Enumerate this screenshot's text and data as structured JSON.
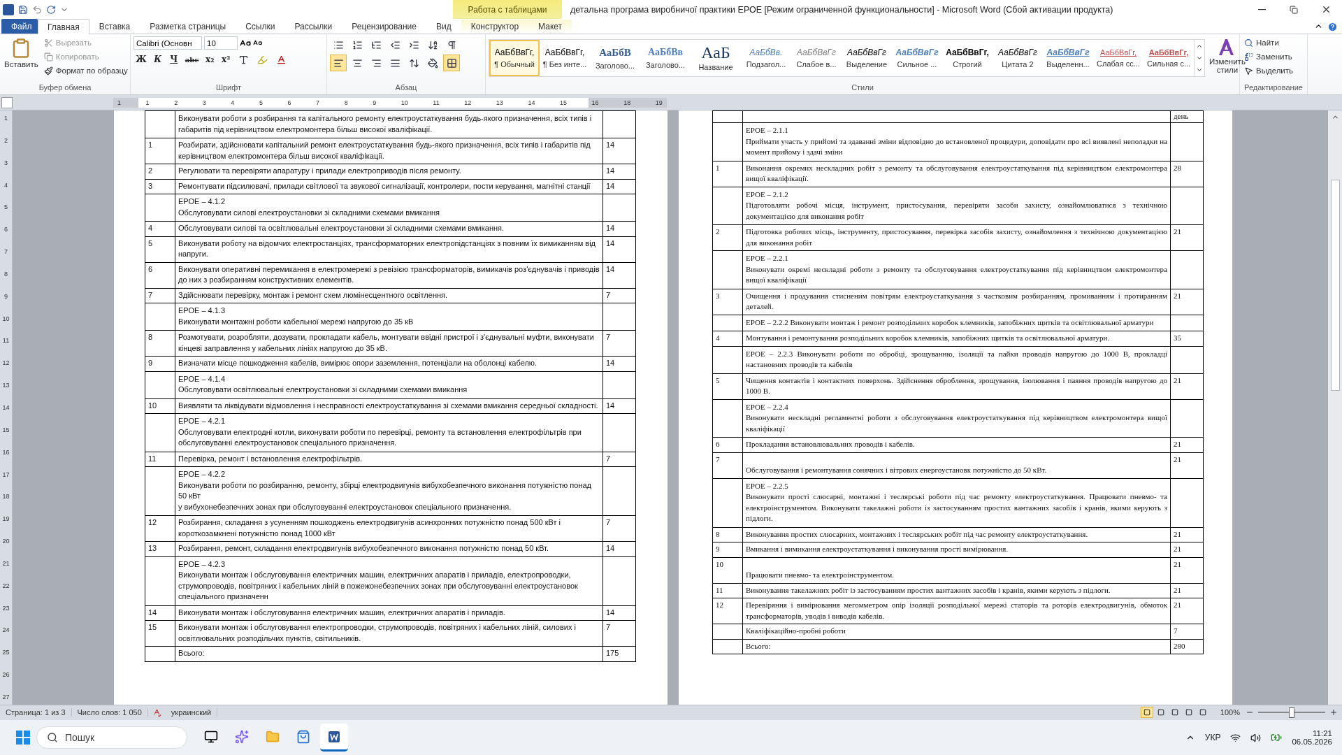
{
  "title_bar": {
    "title": "детальна програма виробничої практики ЕРОЕ [Режим ограниченной функциональности]  -  Microsoft Word (Сбой активации продукта)",
    "context_group": "Работа с таблицами"
  },
  "tabs": [
    {
      "label": "Файл",
      "kind": "file",
      "selected": false
    },
    {
      "label": "Главная",
      "kind": "tab",
      "selected": true
    },
    {
      "label": "Вставка",
      "kind": "tab",
      "selected": false
    },
    {
      "label": "Разметка страницы",
      "kind": "tab",
      "selected": false
    },
    {
      "label": "Ссылки",
      "kind": "tab",
      "selected": false
    },
    {
      "label": "Рассылки",
      "kind": "tab",
      "selected": false
    },
    {
      "label": "Рецензирование",
      "kind": "tab",
      "selected": false
    },
    {
      "label": "Вид",
      "kind": "tab",
      "selected": false
    },
    {
      "label": "Конструктор",
      "kind": "context",
      "selected": false
    },
    {
      "label": "Макет",
      "kind": "context",
      "selected": false
    }
  ],
  "clipboard": {
    "paste": "Вставить",
    "items": [
      {
        "label": "Вырезать",
        "disabled": true
      },
      {
        "label": "Копировать",
        "disabled": true
      },
      {
        "label": "Формат по образцу",
        "disabled": false
      }
    ],
    "group": "Буфер обмена"
  },
  "font": {
    "name": "Calibri (Основн",
    "size": "10",
    "format_buttons": [
      "Ж",
      "К",
      "Ч",
      "abc",
      "x₂",
      "x²"
    ],
    "group": "Шрифт"
  },
  "paragraph": {
    "alignment": [
      {
        "selected": true
      },
      {
        "selected": false
      },
      {
        "selected": false
      },
      {
        "selected": false
      }
    ],
    "group": "Абзац"
  },
  "styles": {
    "items": [
      {
        "preview": "АаБбВвГг,",
        "label": "¶ Обычный",
        "selected": true
      },
      {
        "preview": "АаБбВвГг,",
        "label": "¶ Без инте...",
        "selected": false
      },
      {
        "preview": "АаБбВ",
        "label": "Заголово...",
        "selected": false
      },
      {
        "preview": "АаБбВв",
        "label": "Заголово...",
        "selected": false
      },
      {
        "preview": "АаБ",
        "label": "Название",
        "selected": false
      },
      {
        "preview": "АаБбВв.",
        "label": "Подзагол...",
        "selected": false
      },
      {
        "preview": "АаБбВвГг",
        "label": "Слабое в...",
        "selected": false
      },
      {
        "preview": "АаБбВвГг",
        "label": "Выделение",
        "selected": false
      },
      {
        "preview": "АаБбВвГг",
        "label": "Сильное ...",
        "selected": false
      },
      {
        "preview": "АаБбВвГг,",
        "label": "Строгий",
        "selected": false
      },
      {
        "preview": "АаБбВвГг",
        "label": "Цитата 2",
        "selected": false
      },
      {
        "preview": "АаБбВвГг",
        "label": "Выделенн...",
        "selected": false
      },
      {
        "preview": "АаБбВвГг,",
        "label": "Слабая сс...",
        "selected": false
      },
      {
        "preview": "АаБбВвГг,",
        "label": "Сильная с...",
        "selected": false
      }
    ],
    "change": [
      "Изменить",
      "стили"
    ],
    "group": "Стили"
  },
  "editing": {
    "items": [
      "Найти",
      "Заменить",
      "Выделить"
    ],
    "group": "Редактирование"
  },
  "ruler": [
    "1",
    "1",
    "2",
    "3",
    "4",
    "5",
    "6",
    "7",
    "8",
    "9",
    "10",
    "11",
    "12",
    "13",
    "14",
    "15",
    "16",
    "18",
    "19"
  ],
  "vertical_ruler": [
    "1",
    "2",
    "3",
    "4",
    "5",
    "6",
    "7",
    "8",
    "9",
    "10",
    "11",
    "12",
    "13",
    "14",
    "15",
    "16",
    "17",
    "18",
    "19",
    "20",
    "21",
    "22",
    "23",
    "24",
    "25",
    "26",
    "27"
  ],
  "left_table": [
    {
      "kind": "competency",
      "text": "Виконувати роботи з розбирання та капітального ремонту електроустаткування будь-якого призначення, всіх типів і габаритів під керівництвом електромонтера більш високої кваліфікації."
    },
    {
      "kind": "task",
      "number": "1",
      "text": "Розбирати, здійснювати капітальний ремонт електроустаткування будь-якого призначення, всіх типів і габаритів під керівництвом електромонтера більш високої кваліфікації.",
      "hours": "14"
    },
    {
      "kind": "task",
      "number": "2",
      "text": "Регулювати та перевіряти апаратуру і прилади електроприводів після ремонту.",
      "hours": "14"
    },
    {
      "kind": "task",
      "number": "3",
      "text": "Ремонтувати  підсилювачі, прилади світлової та звукової сигналізації, контролери, пости керування, магнітні станції",
      "hours": "14"
    },
    {
      "kind": "competency",
      "code": "ЕРОЕ  –  4.1.2",
      "text": "Обслуговувати силові електроустановки зі складними схемами вмикання"
    },
    {
      "kind": "task",
      "number": "4",
      "text": "Обслуговувати силові та освітлювальні  електроустановки зі складними схемами вмикання.",
      "hours": "14"
    },
    {
      "kind": "task",
      "number": "5",
      "text": "Виконувати роботу на відомчих електростанціях, трансформаторних електропідстанціях з повним їх вимиканням від напруги.",
      "hours": "14"
    },
    {
      "kind": "task",
      "number": "6",
      "text": "Виконувати оперативні перемикання в електромережі з ревізією трансформаторів, вимикачів роз'єднувачів і приводів до них з розбиранням конструктивних елементів.",
      "hours": "14"
    },
    {
      "kind": "task",
      "number": "7",
      "text": "Здійснювати  перевірку, монтаж і ремонт схем люмінесцентного освітлення.",
      "hours": "7"
    },
    {
      "kind": "competency",
      "code": "ЕРОЕ  –  4.1.3",
      "text": "Виконувати монтажні роботи кабельної мережі напругою до 35 кВ"
    },
    {
      "kind": "task",
      "number": "8",
      "text": "Розмотувати, розробляти, дозувати, прокладати кабель, монтувати  ввідні пристрої і з'єднувальні муфти, виконувати кінцеві заправлення у кабельних лініях напругою до 35 кВ.",
      "hours": "7"
    },
    {
      "kind": "task",
      "number": "9",
      "text": "Визначати місце пошкодження кабелів, вимірює опори заземлення, потенціали на оболонці кабелю.",
      "hours": "14"
    },
    {
      "kind": "competency",
      "code": "ЕРОЕ – 4.1.4",
      "text": "Обслуговувати освітлювальні електроустановки зі складними схемами вмикання"
    },
    {
      "kind": "task",
      "number": "10",
      "text": " Виявляти та ліквідувати відмовлення і несправності електроустаткування зі схемами вмикання середньої складності.",
      "hours": "14"
    },
    {
      "kind": "competency",
      "code": "ЕРОЕ  –  4.2.1",
      "text": "Обслуговувати електродні котли, виконувати роботи по перевірці, ремонту та встановлення електрофільтрів при обслуговуванні електроустановок спеціального призначення."
    },
    {
      "kind": "task",
      "number": "11",
      "text": "Перевірка, ремонт і встановлення електрофільтрів.",
      "hours": "7"
    },
    {
      "kind": "competency",
      "code": "ЕРОЕ  –  4.2.2",
      "text": "Виконувати роботи по розбиранню, ремонту, збірці електродвигунів вибухобезпечного виконання потужністю понад 50 кВт\nу вибухонебезпечних зонах при обслуговуванні електроустановок спеціального призначення."
    },
    {
      "kind": "task",
      "number": "12",
      "text": "Розбирання, складання з усуненням пошкоджень електродвигунів  асинхронних  потужністю понад 500 кВт і короткозамкнені потужністю понад 1000 кВт",
      "hours": "7"
    },
    {
      "kind": "task",
      "number": "13",
      "text": "Розбирання, ремонт, складання електродвигунів вибухобезпечного виконання потужністю понад 50 кВт.",
      "hours": "14"
    },
    {
      "kind": "competency",
      "code": "ЕРОЕ  –  4.2.3",
      "text": "Виконувати монтаж і обслуговування електричних машин, електричних апаратів і приладів, електропроводки, струмопроводів, повітряних і кабельних ліній в пожежонебезпечних зонах при обслуговуванні електроустановок спеціального призначенн"
    },
    {
      "kind": "task",
      "number": "14",
      "text": "Виконувати монтаж і обслуговування електричних машин, електричних апаратів і приладів.",
      "hours": "14"
    },
    {
      "kind": "task",
      "number": "15",
      "text": "Виконувати монтаж і обслуговування електропроводки, струмопроводів, повітряних і кабельних ліній, силових і освітлювальних  розподільчих пунктів, світильників.",
      "hours": "7"
    },
    {
      "kind": "total",
      "text": "Всього:",
      "hours": "175"
    }
  ],
  "right_table": [
    {
      "kind": "header",
      "hours": "день"
    },
    {
      "kind": "competency",
      "code": "ЕРОЕ  –  2.1.1",
      "text": "Приймати участь у прийомі та здаванні зміни відповідно до встановленої процедури, доповідати про всі виявлені неполадки на момент прийому і здачі зміни"
    },
    {
      "kind": "task",
      "number": "1",
      "text": "Виконання   окремих   нескладних  робіт   з ремонту та обслуговування електроустаткування під керівництвом електромонтера вищої кваліфікації.",
      "hours": "28"
    },
    {
      "kind": "competency",
      "code": "ЕРОЕ  –  2.1.2",
      "text": "Підготовляти робочі місця, інструмент, пристосування, перевіряти засоби захисту, ознайомлюватися з технічною документацією для виконання робіт"
    },
    {
      "kind": "task",
      "number": "2",
      "text": "Підготовка  робочих місць, інструменту, пристосування, перевірка засобів захисту, ознайомлення з технічною документацією для виконання робіт",
      "hours": "21"
    },
    {
      "kind": "competency",
      "code": "ЕРОЕ  –    2.2.1",
      "text": "Виконувати окремі нескладні роботи з ремонту та обслуговування електроустаткування під керівництвом електромонтера вищої кваліфікації"
    },
    {
      "kind": "task",
      "number": "3",
      "text": "Очищення  і продування  стисненим повітрям електроустаткування з частковим розбиранням, промиванням і протиранням деталей.",
      "hours": "21"
    },
    {
      "kind": "competency",
      "text": "ЕРОЕ  –   2.2.2  Виконувати монтаж і ремонт розподільчих коробок клемників, запобіжних щитків та освітлювальної арматури"
    },
    {
      "kind": "task",
      "number": "4",
      "text": "Монтування  і ремонтування  розподільних коробок  клемників, запобіжних щитків та освітлювальної арматури.",
      "hours": "35"
    },
    {
      "kind": "competency",
      "text": "ЕРОЕ  –   2.2.3  Виконувати роботи по обробці, зрощуванню, ізоляції та пайки проводів напругою до 1000 В, прокладці настановних проводів та кабелів"
    },
    {
      "kind": "task",
      "number": "5",
      "text": "Чищення контактів і контактних  поверхонь. Здійснення оброблення, зрощування, ізолювання і паяння  проводів напругою до 1000 В.",
      "hours": "21"
    },
    {
      "kind": "competency",
      "code": "ЕРОЕ  –    2.2.4",
      "text": "Виконувати нескладні регламентні роботи з обслуговування електроустаткування під керівництвом електромонтера вищої кваліфікації"
    },
    {
      "kind": "task",
      "number": "6",
      "text": "Прокладання встановлювальних проводів і кабелів.",
      "hours": "21"
    },
    {
      "kind": "task",
      "number": "7",
      "text": "\nОбслуговування і ремонтування  сонячних  і вітрових енергоустановк потужністю до 50 кВт.",
      "hours": "21"
    },
    {
      "kind": "competency",
      "code": "ЕРОЕ  –    2.2.5",
      "text": "Виконувати прості слюсарні, монтажні і теслярські роботи під час ремонту електроустаткування. Працювати пневмо- та електроінструментом. Виконувати такелажні роботи із застосуванням простих вантажних засобів і кранів, якими керують з підлоги."
    },
    {
      "kind": "task",
      "number": "8",
      "text": "Виконування  простих слюсарних, монтажних і теслярських робіт  під час ремонту електроустаткування.",
      "hours": "21"
    },
    {
      "kind": "task",
      "number": "9",
      "text": "Вмикання  і вимикання електроустаткування і виконування  прості вимірювання.",
      "hours": "21"
    },
    {
      "kind": "task",
      "number": "10",
      "text": "\nПрацювати пневмо- та електроінструментом.",
      "hours": "21"
    },
    {
      "kind": "task",
      "number": "11",
      "text": "Виконування  такелажних  робіт із застосуванням простих вантажних засобів і кранів, якими керують з підлоги.",
      "hours": "21"
    },
    {
      "kind": "task",
      "number": "12",
      "text": "Перевіряння   і вимірювання   мегомметром опір ізоляції розподільної мережі статорів та роторів електродвигунів, обмоток  трансформаторів, уводів і виводів  кабелів.",
      "hours": "21"
    },
    {
      "kind": "total",
      "text": "Кваліфікаційно-пробні  роботи",
      "hours": "7"
    },
    {
      "kind": "total",
      "text": "Всього:",
      "hours": "280"
    }
  ],
  "status_bar": {
    "page": "Страница: 1 из 3",
    "words": "Число слов: 1 050",
    "language": "украинский",
    "views": [
      {
        "selected": true
      },
      {
        "selected": false
      },
      {
        "selected": false
      },
      {
        "selected": false
      },
      {
        "selected": false
      }
    ],
    "zoom": "100%",
    "zoom_slider": {
      "level": 0.5
    }
  },
  "taskbar": {
    "search": "Пошук",
    "apps": [
      {
        "kind": "desktop",
        "selected": false
      },
      {
        "kind": "copilot",
        "selected": false
      },
      {
        "kind": "folder",
        "selected": false
      },
      {
        "kind": "store",
        "selected": false
      },
      {
        "kind": "word",
        "selected": true
      }
    ],
    "language": "УКР",
    "time": "11:21",
    "date": "06.05.2026"
  }
}
